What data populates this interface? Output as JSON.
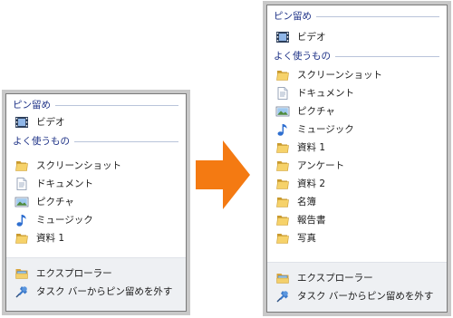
{
  "panels": {
    "left": {
      "pinned_title": "ピン留め",
      "pinned": [
        {
          "icon": "video-icon",
          "label": "ビデオ"
        }
      ],
      "frequent_title": "よく使うもの",
      "frequent": [
        {
          "icon": "folder-icon",
          "label": "スクリーンショット"
        },
        {
          "icon": "document-icon",
          "label": "ドキュメント"
        },
        {
          "icon": "picture-icon",
          "label": "ピクチャ"
        },
        {
          "icon": "music-icon",
          "label": "ミュージック"
        },
        {
          "icon": "folder-icon",
          "label": "資料 1"
        }
      ],
      "tasks": [
        {
          "icon": "explorer-icon",
          "label": "エクスプローラー"
        },
        {
          "icon": "unpin-icon",
          "label": "タスク バーからピン留めを外す"
        }
      ]
    },
    "right": {
      "pinned_title": "ピン留め",
      "pinned": [
        {
          "icon": "video-icon",
          "label": "ビデオ"
        }
      ],
      "frequent_title": "よく使うもの",
      "frequent": [
        {
          "icon": "folder-icon",
          "label": "スクリーンショット"
        },
        {
          "icon": "document-icon",
          "label": "ドキュメント"
        },
        {
          "icon": "picture-icon",
          "label": "ピクチャ"
        },
        {
          "icon": "music-icon",
          "label": "ミュージック"
        },
        {
          "icon": "folder-icon",
          "label": "資料 1"
        },
        {
          "icon": "folder-icon",
          "label": "アンケート"
        },
        {
          "icon": "folder-icon",
          "label": "資料 2"
        },
        {
          "icon": "folder-icon",
          "label": "名簿"
        },
        {
          "icon": "folder-icon",
          "label": "報告書"
        },
        {
          "icon": "folder-icon",
          "label": "写真"
        }
      ],
      "tasks": [
        {
          "icon": "explorer-icon",
          "label": "エクスプローラー"
        },
        {
          "icon": "unpin-icon",
          "label": "タスク バーからピン留めを外す"
        }
      ]
    }
  },
  "arrow": {
    "icon": "right-arrow-icon",
    "color": "#f47a12"
  },
  "colors": {
    "header_text": "#1e3287",
    "header_rule": "#b9c4da",
    "task_area": "#eef0f3",
    "border": "#7a7a7a"
  }
}
